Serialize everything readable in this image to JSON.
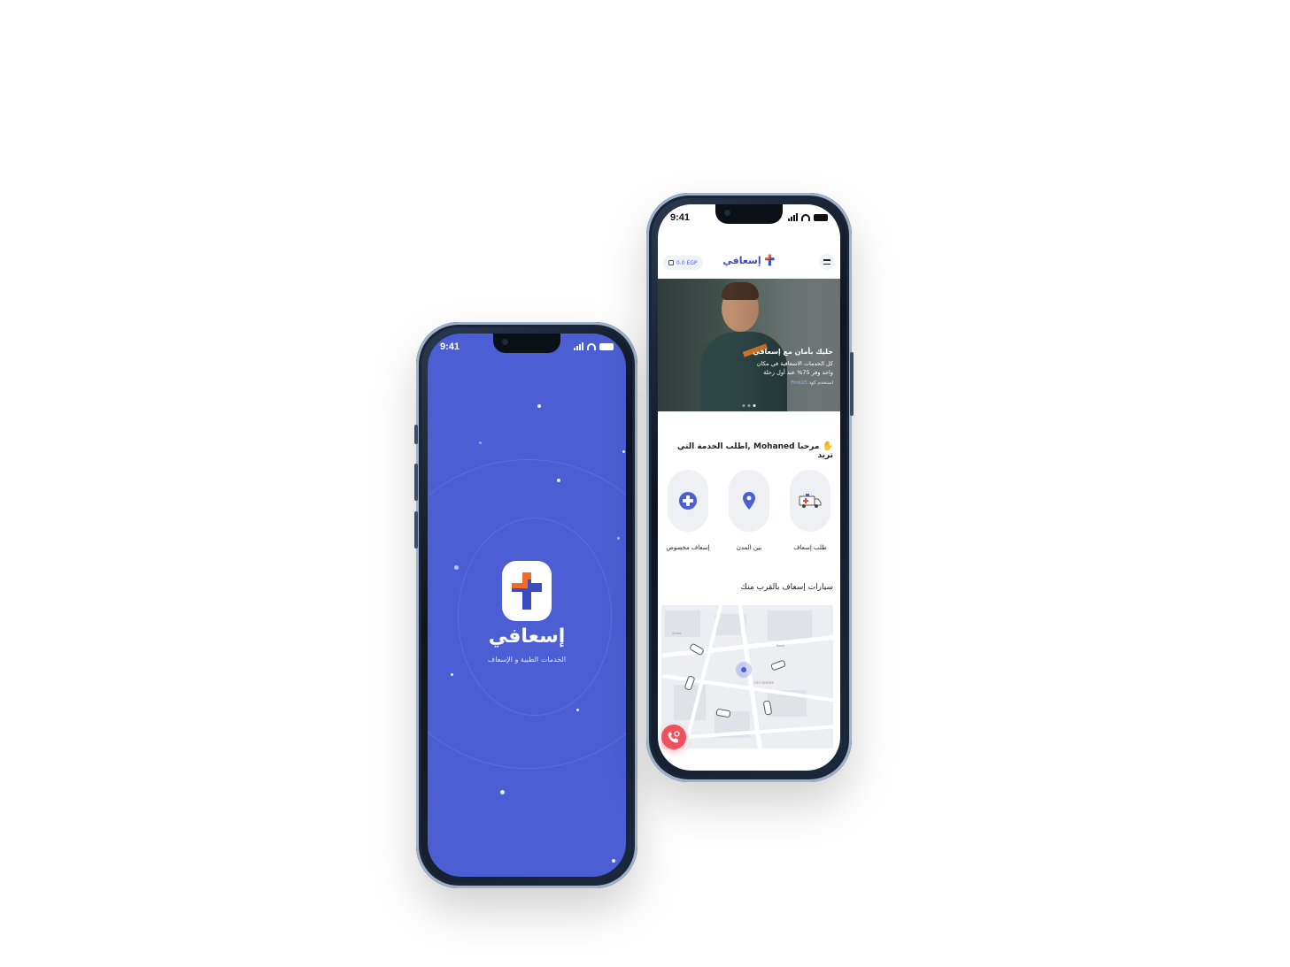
{
  "splash": {
    "status_time": "9:41",
    "app_name": "إسعافي",
    "tagline": "الخدمات الطبية و الإسعاف",
    "bg_color": "#4b5ed3",
    "logo_icon": "plus-cross-logo-icon"
  },
  "home": {
    "status_time": "9:41",
    "wallet_balance": "0.0 EGP",
    "brand_name": "إسعافي",
    "banner": {
      "title": "خليك بأمان مع إسعافي",
      "line1": "كل الخدمات الاسعافية في مكان",
      "line2": "واحد وفر 75% عند أول رحلة",
      "code_prefix": "استخدم كود",
      "code": "First25",
      "slide_count": 3,
      "active_slide": 3
    },
    "greeting": "مرحبا Mohaned ,اطلب الخدمة التي تريد",
    "services": [
      {
        "label": "طلب إسعاف",
        "icon": "ambulance-icon"
      },
      {
        "label": "بين المدن",
        "icon": "location-pin-icon"
      },
      {
        "label": "إسعاف مخصوص",
        "icon": "medical-plus-icon"
      }
    ],
    "nearby_title": "سيارات إسعاف بالقرب منك",
    "emergency_icon": "phone-emergency-icon",
    "colors": {
      "accent": "#4b5ed3",
      "logo_orange": "#f06a2a",
      "sos": "#f0505c"
    }
  }
}
